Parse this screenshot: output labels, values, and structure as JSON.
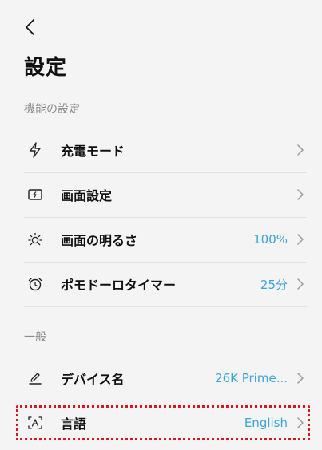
{
  "title": "設定",
  "sections": [
    {
      "label": "機能の設定",
      "items": [
        {
          "label": "充電モード",
          "value": "",
          "icon": "bolt-icon"
        },
        {
          "label": "画面設定",
          "value": "",
          "icon": "screen-icon"
        },
        {
          "label": "画面の明るさ",
          "value": "100%",
          "icon": "brightness-icon"
        },
        {
          "label": "ポモドーロタイマー",
          "value": "25分",
          "icon": "alarm-clock-icon"
        }
      ]
    },
    {
      "label": "一般",
      "items": [
        {
          "label": "デバイス名",
          "value": "26K Prime...",
          "icon": "pen-icon"
        },
        {
          "label": "言語",
          "value": "English",
          "icon": "language-icon"
        }
      ]
    }
  ],
  "colors": {
    "accent": "#3aa6d8",
    "highlight": "#d9141e"
  }
}
